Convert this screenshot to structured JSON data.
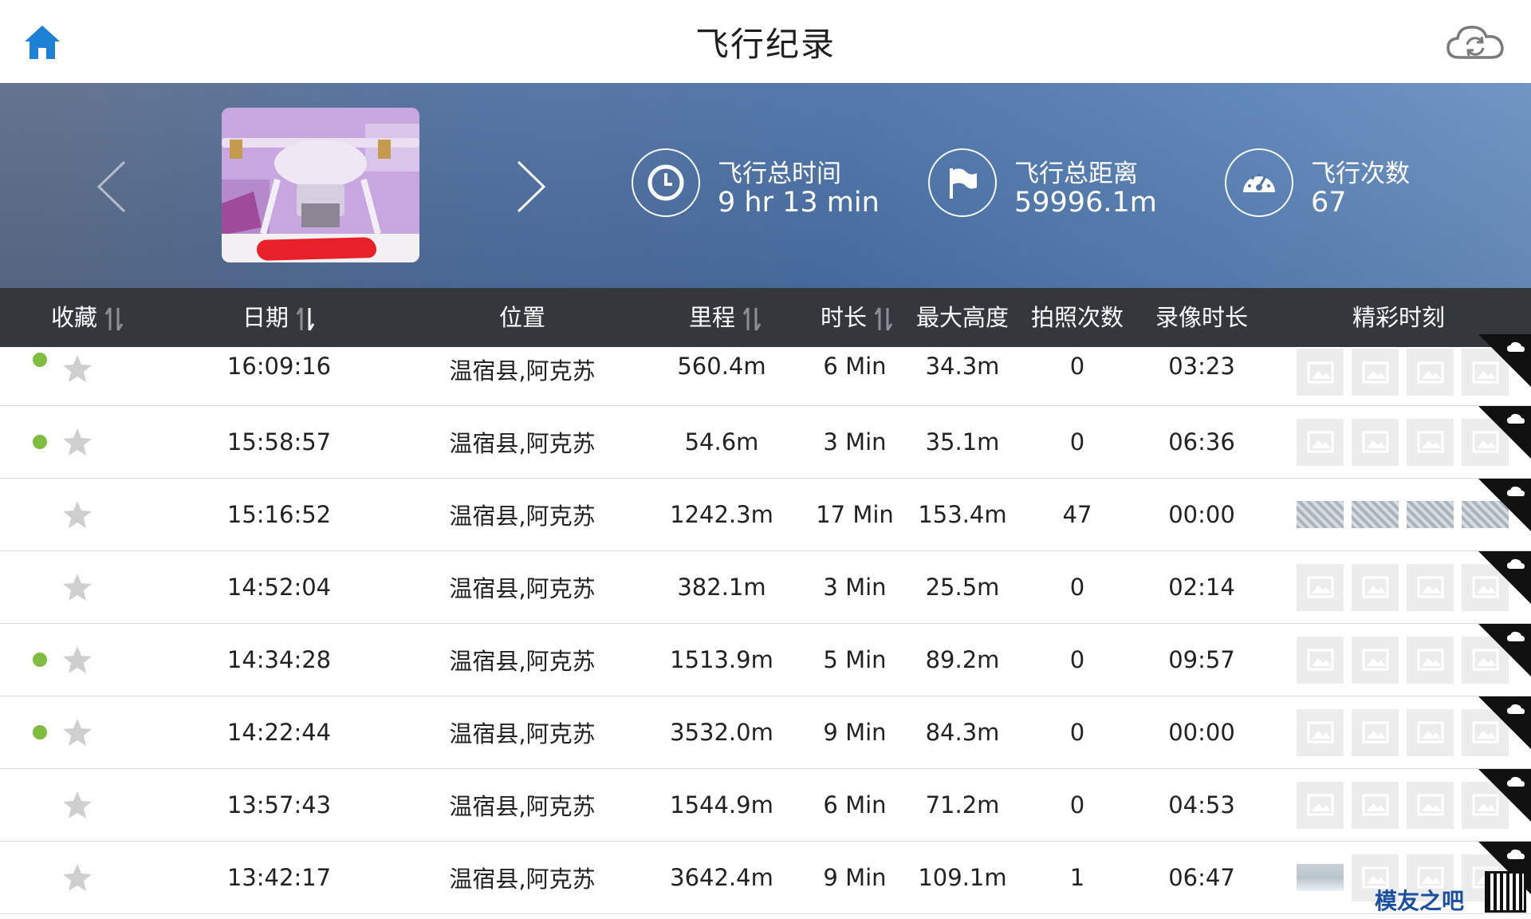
{
  "header": {
    "title": "飞行纪录",
    "home_icon": "home-icon",
    "sync_icon": "cloud-sync-icon"
  },
  "banner": {
    "stats": {
      "total_time": {
        "label": "飞行总时间",
        "value": "9 hr 13 min",
        "icon": "clock-icon"
      },
      "total_distance": {
        "label": "飞行总距离",
        "value": "59996.1m",
        "icon": "flag-icon"
      },
      "flight_count": {
        "label": "飞行次数",
        "value": "67",
        "icon": "speedometer-icon"
      }
    }
  },
  "columns": {
    "favorite": "收藏",
    "date": "日期",
    "location": "位置",
    "distance": "里程",
    "duration": "时长",
    "max_altitude": "最大高度",
    "photo_count": "拍照次数",
    "video_duration": "录像时长",
    "highlights": "精彩时刻"
  },
  "rows": [
    {
      "synced": true,
      "time": "16:09:16",
      "location": "温宿县,阿克苏",
      "distance": "560.4m",
      "duration": "6 Min",
      "max_altitude": "34.3m",
      "photos": "0",
      "video": "03:23",
      "thumbs": [
        "empty",
        "empty",
        "empty",
        "empty"
      ]
    },
    {
      "synced": true,
      "time": "15:58:57",
      "location": "温宿县,阿克苏",
      "distance": "54.6m",
      "duration": "3 Min",
      "max_altitude": "35.1m",
      "photos": "0",
      "video": "06:36",
      "thumbs": [
        "empty",
        "empty",
        "empty",
        "empty"
      ]
    },
    {
      "synced": false,
      "time": "15:16:52",
      "location": "温宿县,阿克苏",
      "distance": "1242.3m",
      "duration": "17 Min",
      "max_altitude": "153.4m",
      "photos": "47",
      "video": "00:00",
      "thumbs": [
        "photo",
        "photo",
        "photo",
        "photo"
      ]
    },
    {
      "synced": false,
      "time": "14:52:04",
      "location": "温宿县,阿克苏",
      "distance": "382.1m",
      "duration": "3 Min",
      "max_altitude": "25.5m",
      "photos": "0",
      "video": "02:14",
      "thumbs": [
        "empty",
        "empty",
        "empty",
        "empty"
      ]
    },
    {
      "synced": true,
      "time": "14:34:28",
      "location": "温宿县,阿克苏",
      "distance": "1513.9m",
      "duration": "5 Min",
      "max_altitude": "89.2m",
      "photos": "0",
      "video": "09:57",
      "thumbs": [
        "empty",
        "empty",
        "empty",
        "empty"
      ]
    },
    {
      "synced": true,
      "time": "14:22:44",
      "location": "温宿县,阿克苏",
      "distance": "3532.0m",
      "duration": "9 Min",
      "max_altitude": "84.3m",
      "photos": "0",
      "video": "00:00",
      "thumbs": [
        "empty",
        "empty",
        "empty",
        "empty"
      ]
    },
    {
      "synced": false,
      "time": "13:57:43",
      "location": "温宿县,阿克苏",
      "distance": "1544.9m",
      "duration": "6 Min",
      "max_altitude": "71.2m",
      "photos": "0",
      "video": "04:53",
      "thumbs": [
        "empty",
        "empty",
        "empty",
        "empty"
      ]
    },
    {
      "synced": false,
      "time": "13:42:17",
      "location": "温宿县,阿克苏",
      "distance": "3642.4m",
      "duration": "9 Min",
      "max_altitude": "109.1m",
      "photos": "1",
      "video": "06:47",
      "thumbs": [
        "snow",
        "empty",
        "empty",
        "empty"
      ]
    }
  ],
  "colors": {
    "accent": "#1d82d6",
    "header_bar": "#34383d",
    "sync_dot": "#80bc3f",
    "star": "#cfcfcf"
  },
  "watermark": {
    "text": "模友之吧"
  }
}
